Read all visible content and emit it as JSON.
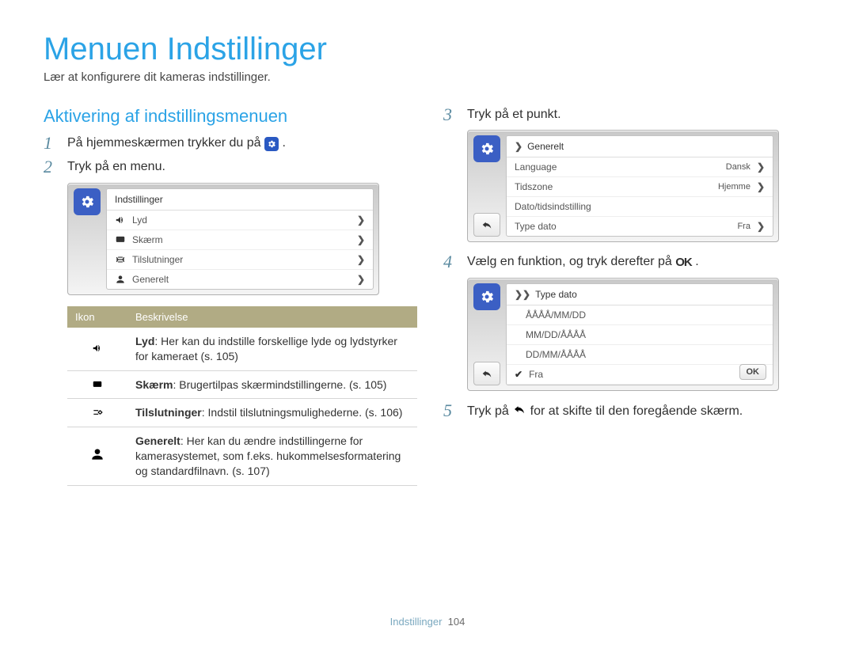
{
  "page_title": "Menuen Indstillinger",
  "subtitle": "Lær at konfigurere dit kameras indstillinger.",
  "section_heading": "Aktivering af indstillingsmenuen",
  "steps": {
    "s1_a": "På hjemmeskærmen trykker du på ",
    "s1_b": ".",
    "s2": "Tryk på en menu.",
    "s3": "Tryk på et punkt.",
    "s4_a": "Vælg en funktion, og tryk derefter på ",
    "s4_b": ".",
    "s5_a": "Tryk på ",
    "s5_b": " for at skifte til den foregående skærm."
  },
  "shot1": {
    "title": "Indstillinger",
    "rows": [
      {
        "label": "Lyd"
      },
      {
        "label": "Skærm"
      },
      {
        "label": "Tilslutninger"
      },
      {
        "label": "Generelt"
      }
    ]
  },
  "shot2": {
    "title": "Generelt",
    "rows": [
      {
        "label": "Language",
        "value": "Dansk",
        "arrow": true
      },
      {
        "label": "Tidszone",
        "value": "Hjemme",
        "arrow": true
      },
      {
        "label": "Dato/tidsindstilling"
      },
      {
        "label": "Type dato",
        "value": "Fra",
        "arrow": true
      }
    ]
  },
  "shot3": {
    "title": "Type dato",
    "options": [
      "ÅÅÅÅ/MM/DD",
      "MM/DD/ÅÅÅÅ",
      "DD/MM/ÅÅÅÅ"
    ],
    "selected": "Fra",
    "ok": "OK"
  },
  "ok_label": "OK",
  "table": {
    "head_icon": "Ikon",
    "head_desc": "Beskrivelse",
    "rows": [
      {
        "title": "Lyd",
        "desc": ": Her kan du indstille forskellige lyde og lydstyrker for kameraet (s. 105)"
      },
      {
        "title": "Skærm",
        "desc": ": Brugertilpas skærmindstillingerne. (s. 105)"
      },
      {
        "title": "Tilslutninger",
        "desc": ": Indstil tilslutningsmulighederne. (s. 106)"
      },
      {
        "title": "Generelt",
        "desc": ": Her kan du ændre indstillingerne for kamerasystemet, som f.eks. hukommelsesformatering og standardfilnavn. (s. 107)"
      }
    ]
  },
  "footer_section": "Indstillinger",
  "footer_page": "104"
}
